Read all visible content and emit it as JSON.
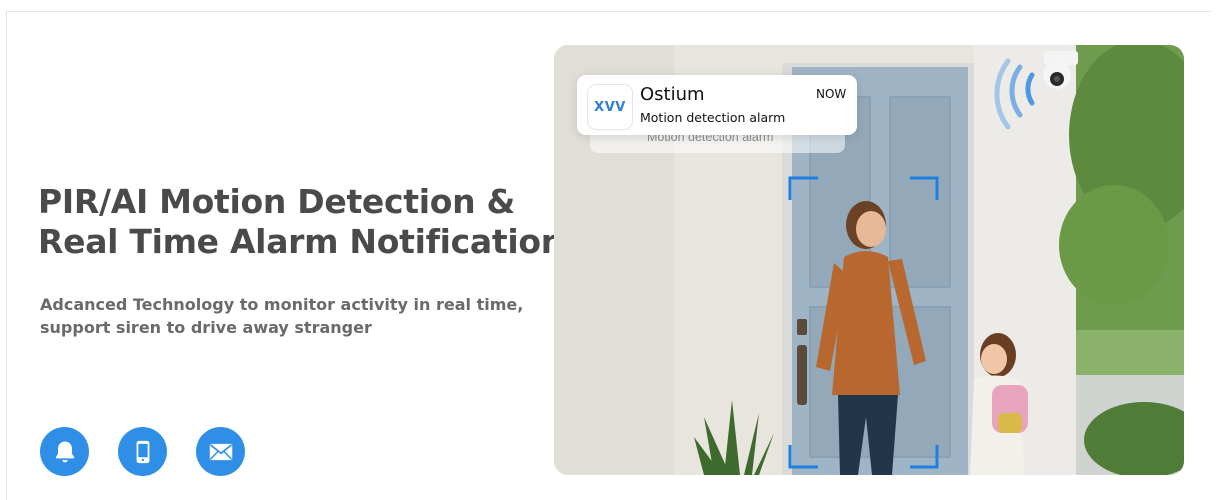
{
  "headline": {
    "line1": "PIR/AI Motion Detection &",
    "line2": "Real Time Alarm Notification"
  },
  "subheadline": {
    "line1": "Adcanced Technology to monitor activity in real time,",
    "line2": "support siren to drive away stranger"
  },
  "feature_icons": [
    {
      "icon": "bell-icon"
    },
    {
      "icon": "phone-icon"
    },
    {
      "icon": "mail-icon"
    }
  ],
  "notification": {
    "app_logo_text": "XVV",
    "app_name": "Ostium",
    "message": "Motion detection alarm",
    "time": "NOW",
    "ghost_message": "Motion detection alarm"
  },
  "colors": {
    "accent": "#2f8fe6",
    "frame_blue": "#1e7fe0",
    "headline": "#4a4a4a",
    "subtext": "#6a6a6a"
  }
}
